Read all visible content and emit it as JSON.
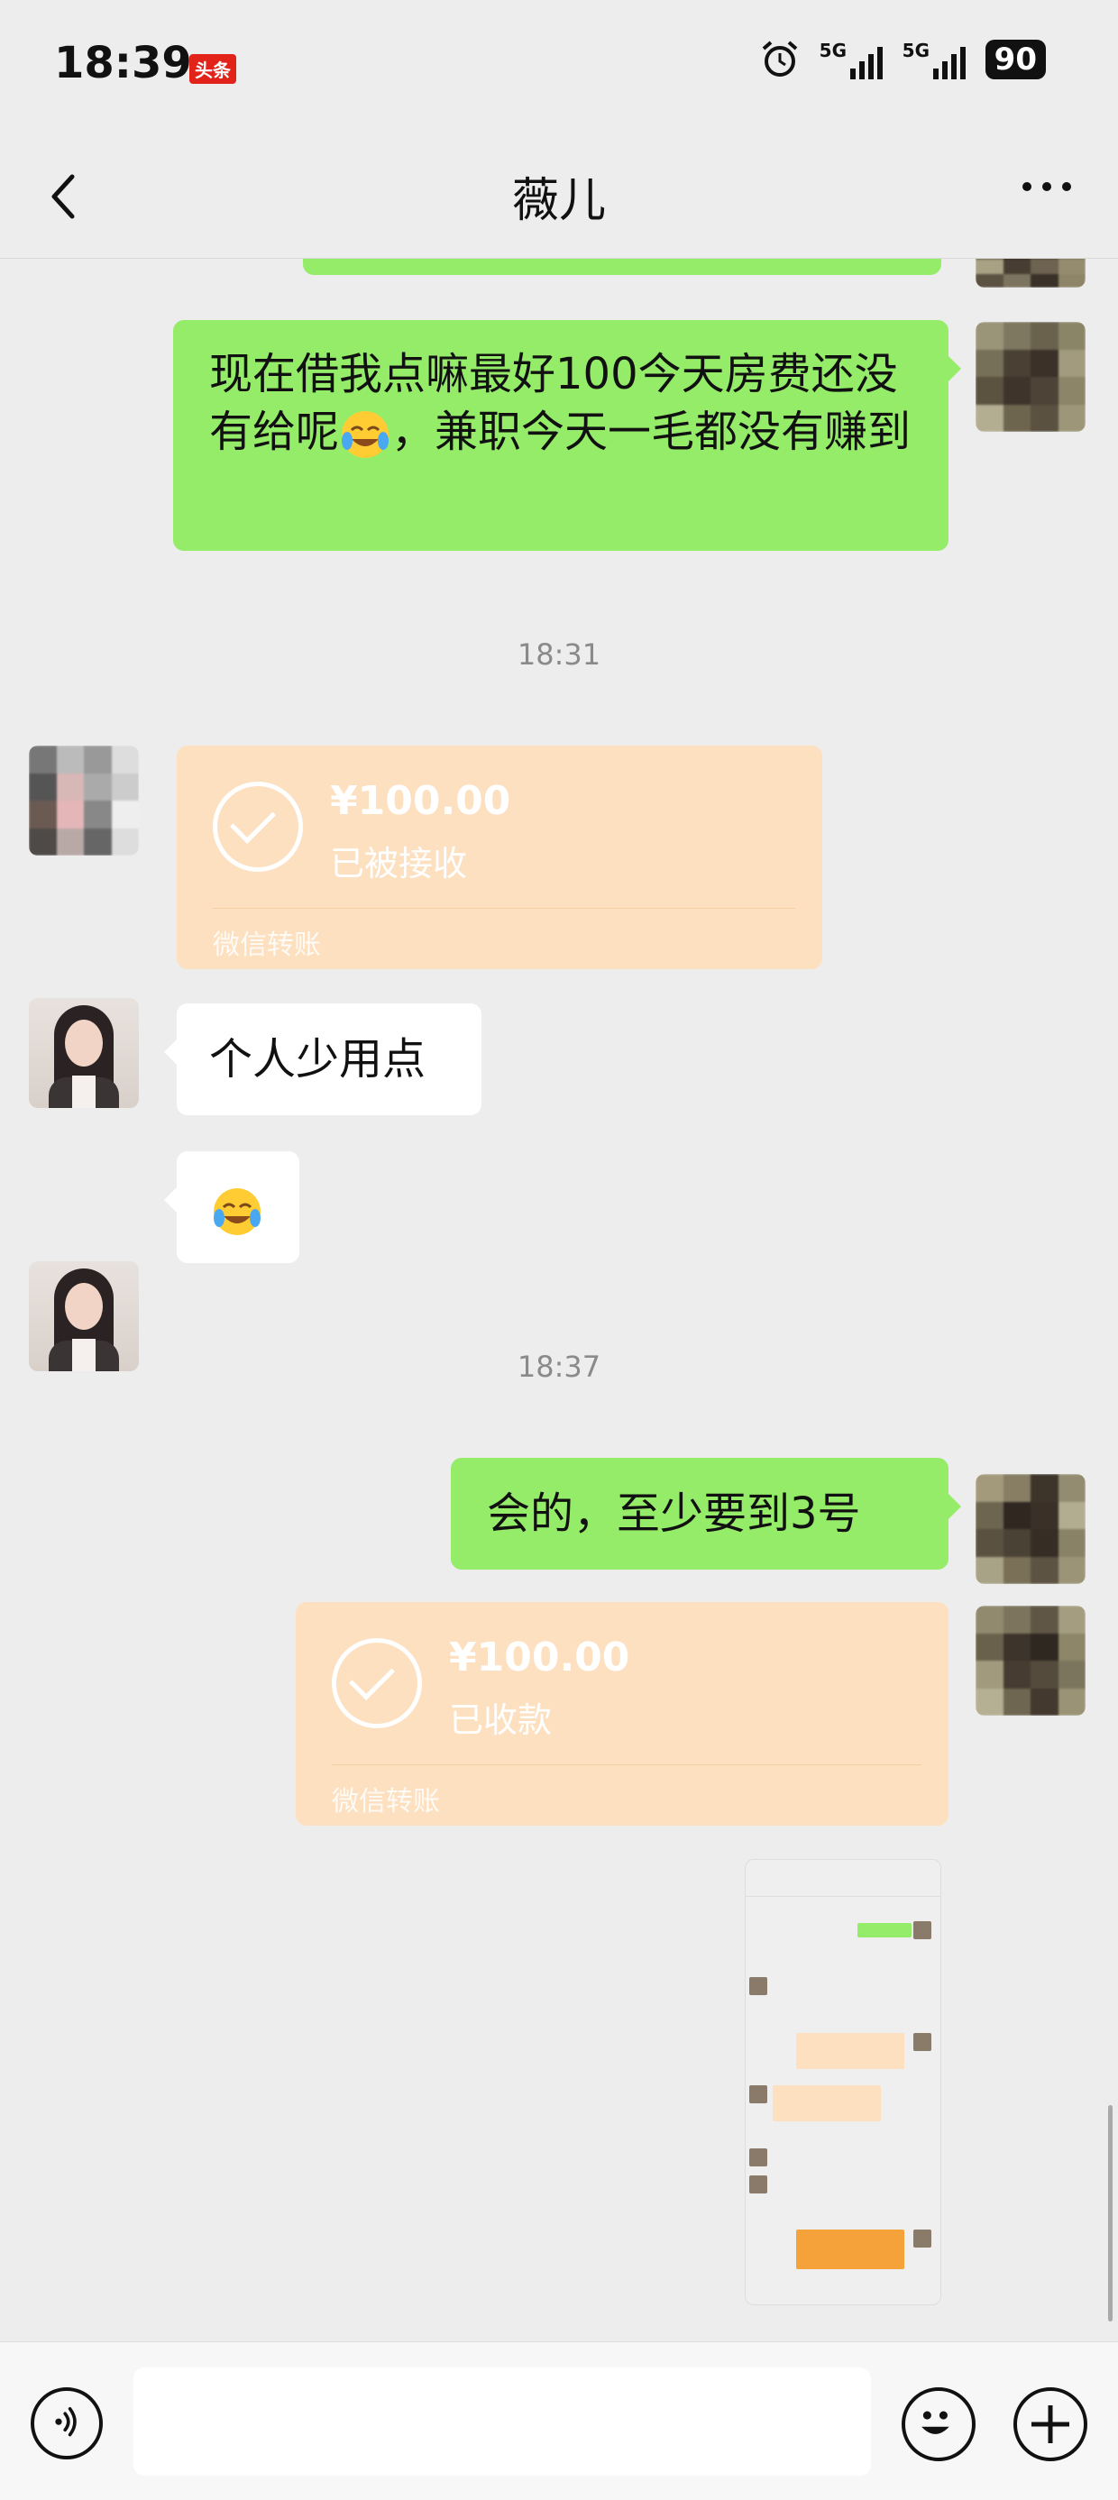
{
  "status_bar": {
    "time": "18:39",
    "app_badge": "头条",
    "signal1_label": "5G",
    "signal2_label": "5G",
    "battery": "90"
  },
  "header": {
    "title": "薇儿"
  },
  "messages": {
    "m1_text": "现在借我点嘛最好100今天房费还没有给呢",
    "m1_text2": "，兼职今天一毛都没有赚到",
    "ts1": "18:31",
    "transfer1": {
      "amount": "¥100.00",
      "status": "已被接收",
      "footer": "微信转账"
    },
    "m2_text": "个人少用点",
    "ts2": "18:37",
    "m3_text": "会的，至少要到3号",
    "transfer2": {
      "amount": "¥100.00",
      "status": "已收款",
      "footer": "微信转账"
    }
  },
  "colors": {
    "sent_bubble": "#95ec69",
    "received_bubble": "#ffffff",
    "transfer_bubble": "#fde0c0",
    "background": "#ededed"
  },
  "input_bar": {
    "placeholder": ""
  }
}
